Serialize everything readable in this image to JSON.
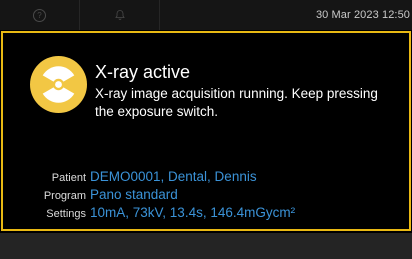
{
  "topbar": {
    "help_icon": "help-icon",
    "notify_icon": "bell-icon",
    "datetime": "30 Mar 2023 12:50"
  },
  "dialog": {
    "border_color": "#e9b913",
    "icon": "radiation-hazard-icon",
    "title": "X-ray active",
    "message": "X-ray image acquisition running. Keep pressing the exposure switch."
  },
  "details": {
    "patient_label": "Patient",
    "patient_value": "DEMO0001, Dental, Dennis",
    "program_label": "Program",
    "program_value": "Pano standard",
    "settings_label": "Settings",
    "settings_value": "10mA, 73kV, 13.4s, 146.4mGycm²"
  },
  "colors": {
    "accent_value": "#3b93d8",
    "warning": "#e9b913"
  }
}
